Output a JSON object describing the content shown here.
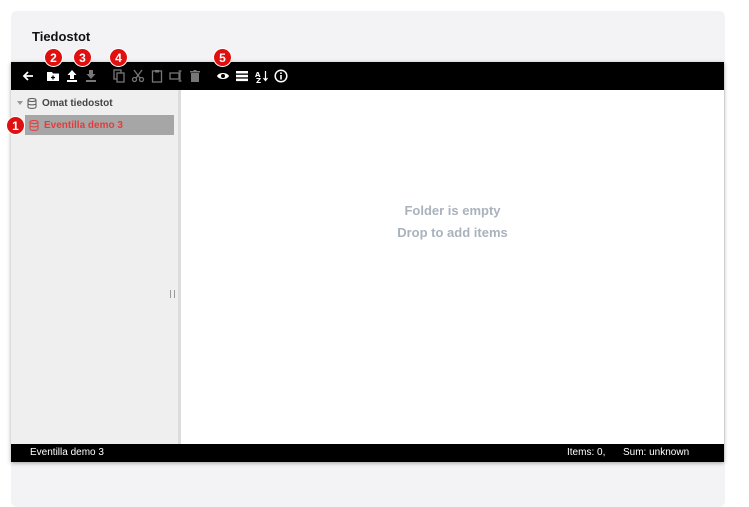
{
  "page": {
    "title": "Tiedostot"
  },
  "toolbar": {
    "buttons": [
      {
        "name": "back",
        "icon": "arrow-left-icon",
        "enabled": true
      },
      {
        "name": "new-folder",
        "icon": "folder-plus-icon",
        "enabled": true
      },
      {
        "name": "upload",
        "icon": "upload-icon",
        "enabled": true
      },
      {
        "name": "download",
        "icon": "download-icon",
        "enabled": false
      },
      {
        "name": "copy",
        "icon": "copy-icon",
        "enabled": false
      },
      {
        "name": "cut",
        "icon": "scissors-icon",
        "enabled": false
      },
      {
        "name": "paste",
        "icon": "clipboard-icon",
        "enabled": false
      },
      {
        "name": "rename",
        "icon": "rename-icon",
        "enabled": false
      },
      {
        "name": "delete",
        "icon": "trash-icon",
        "enabled": false
      },
      {
        "name": "preview",
        "icon": "eye-icon",
        "enabled": true
      },
      {
        "name": "view-list",
        "icon": "list-icon",
        "enabled": true
      },
      {
        "name": "sort",
        "icon": "sort-az-icon",
        "enabled": true
      },
      {
        "name": "info",
        "icon": "info-icon",
        "enabled": true
      }
    ]
  },
  "tree": {
    "root_label": "Omat tiedostot",
    "selected_label": "Eventilla demo 3"
  },
  "content": {
    "empty_line1": "Folder is empty",
    "empty_line2": "Drop to add items"
  },
  "status": {
    "path": "Eventilla demo 3",
    "items": "Items: 0,",
    "sum": "Sum: unknown"
  },
  "badges": [
    "1",
    "2",
    "3",
    "4",
    "5"
  ],
  "colors": {
    "badge": "#e01010",
    "selected_text": "#e43c3c",
    "toolbar_bg": "#000000",
    "empty_text": "#a9b2bd"
  }
}
